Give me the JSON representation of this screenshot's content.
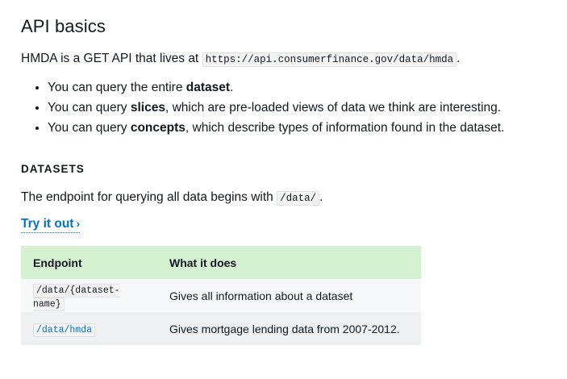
{
  "title": "API basics",
  "intro": {
    "prefix": "HMDA is a GET API that lives at",
    "url": "https://api.consumerfinance.gov/data/hmda",
    "suffix": "."
  },
  "bullets": [
    {
      "pre": "You can query the entire ",
      "bold": "dataset",
      "post": "."
    },
    {
      "pre": "You can query ",
      "bold": "slices",
      "post": ", which are pre-loaded views of data we think are interesting."
    },
    {
      "pre": "You can query ",
      "bold": "concepts",
      "post": ", which describe types of information found in the dataset."
    }
  ],
  "datasets": {
    "heading": "DATASETS",
    "line_prefix": "The endpoint for querying all data begins with",
    "line_code": "/data/",
    "line_suffix": ".",
    "try_label": "Try it out",
    "try_chevron": "›"
  },
  "table": {
    "headers": [
      "Endpoint",
      "What it does"
    ],
    "rows": [
      {
        "endpoint": "/data/{dataset-name}",
        "desc": "Gives all information about a dataset",
        "is_link": false
      },
      {
        "endpoint": "/data/hmda",
        "desc": "Gives mortgage lending data from 2007-2012.",
        "is_link": true
      }
    ]
  },
  "colors": {
    "link": "#0072ce",
    "table_header_bg": "#d6f0d2"
  }
}
